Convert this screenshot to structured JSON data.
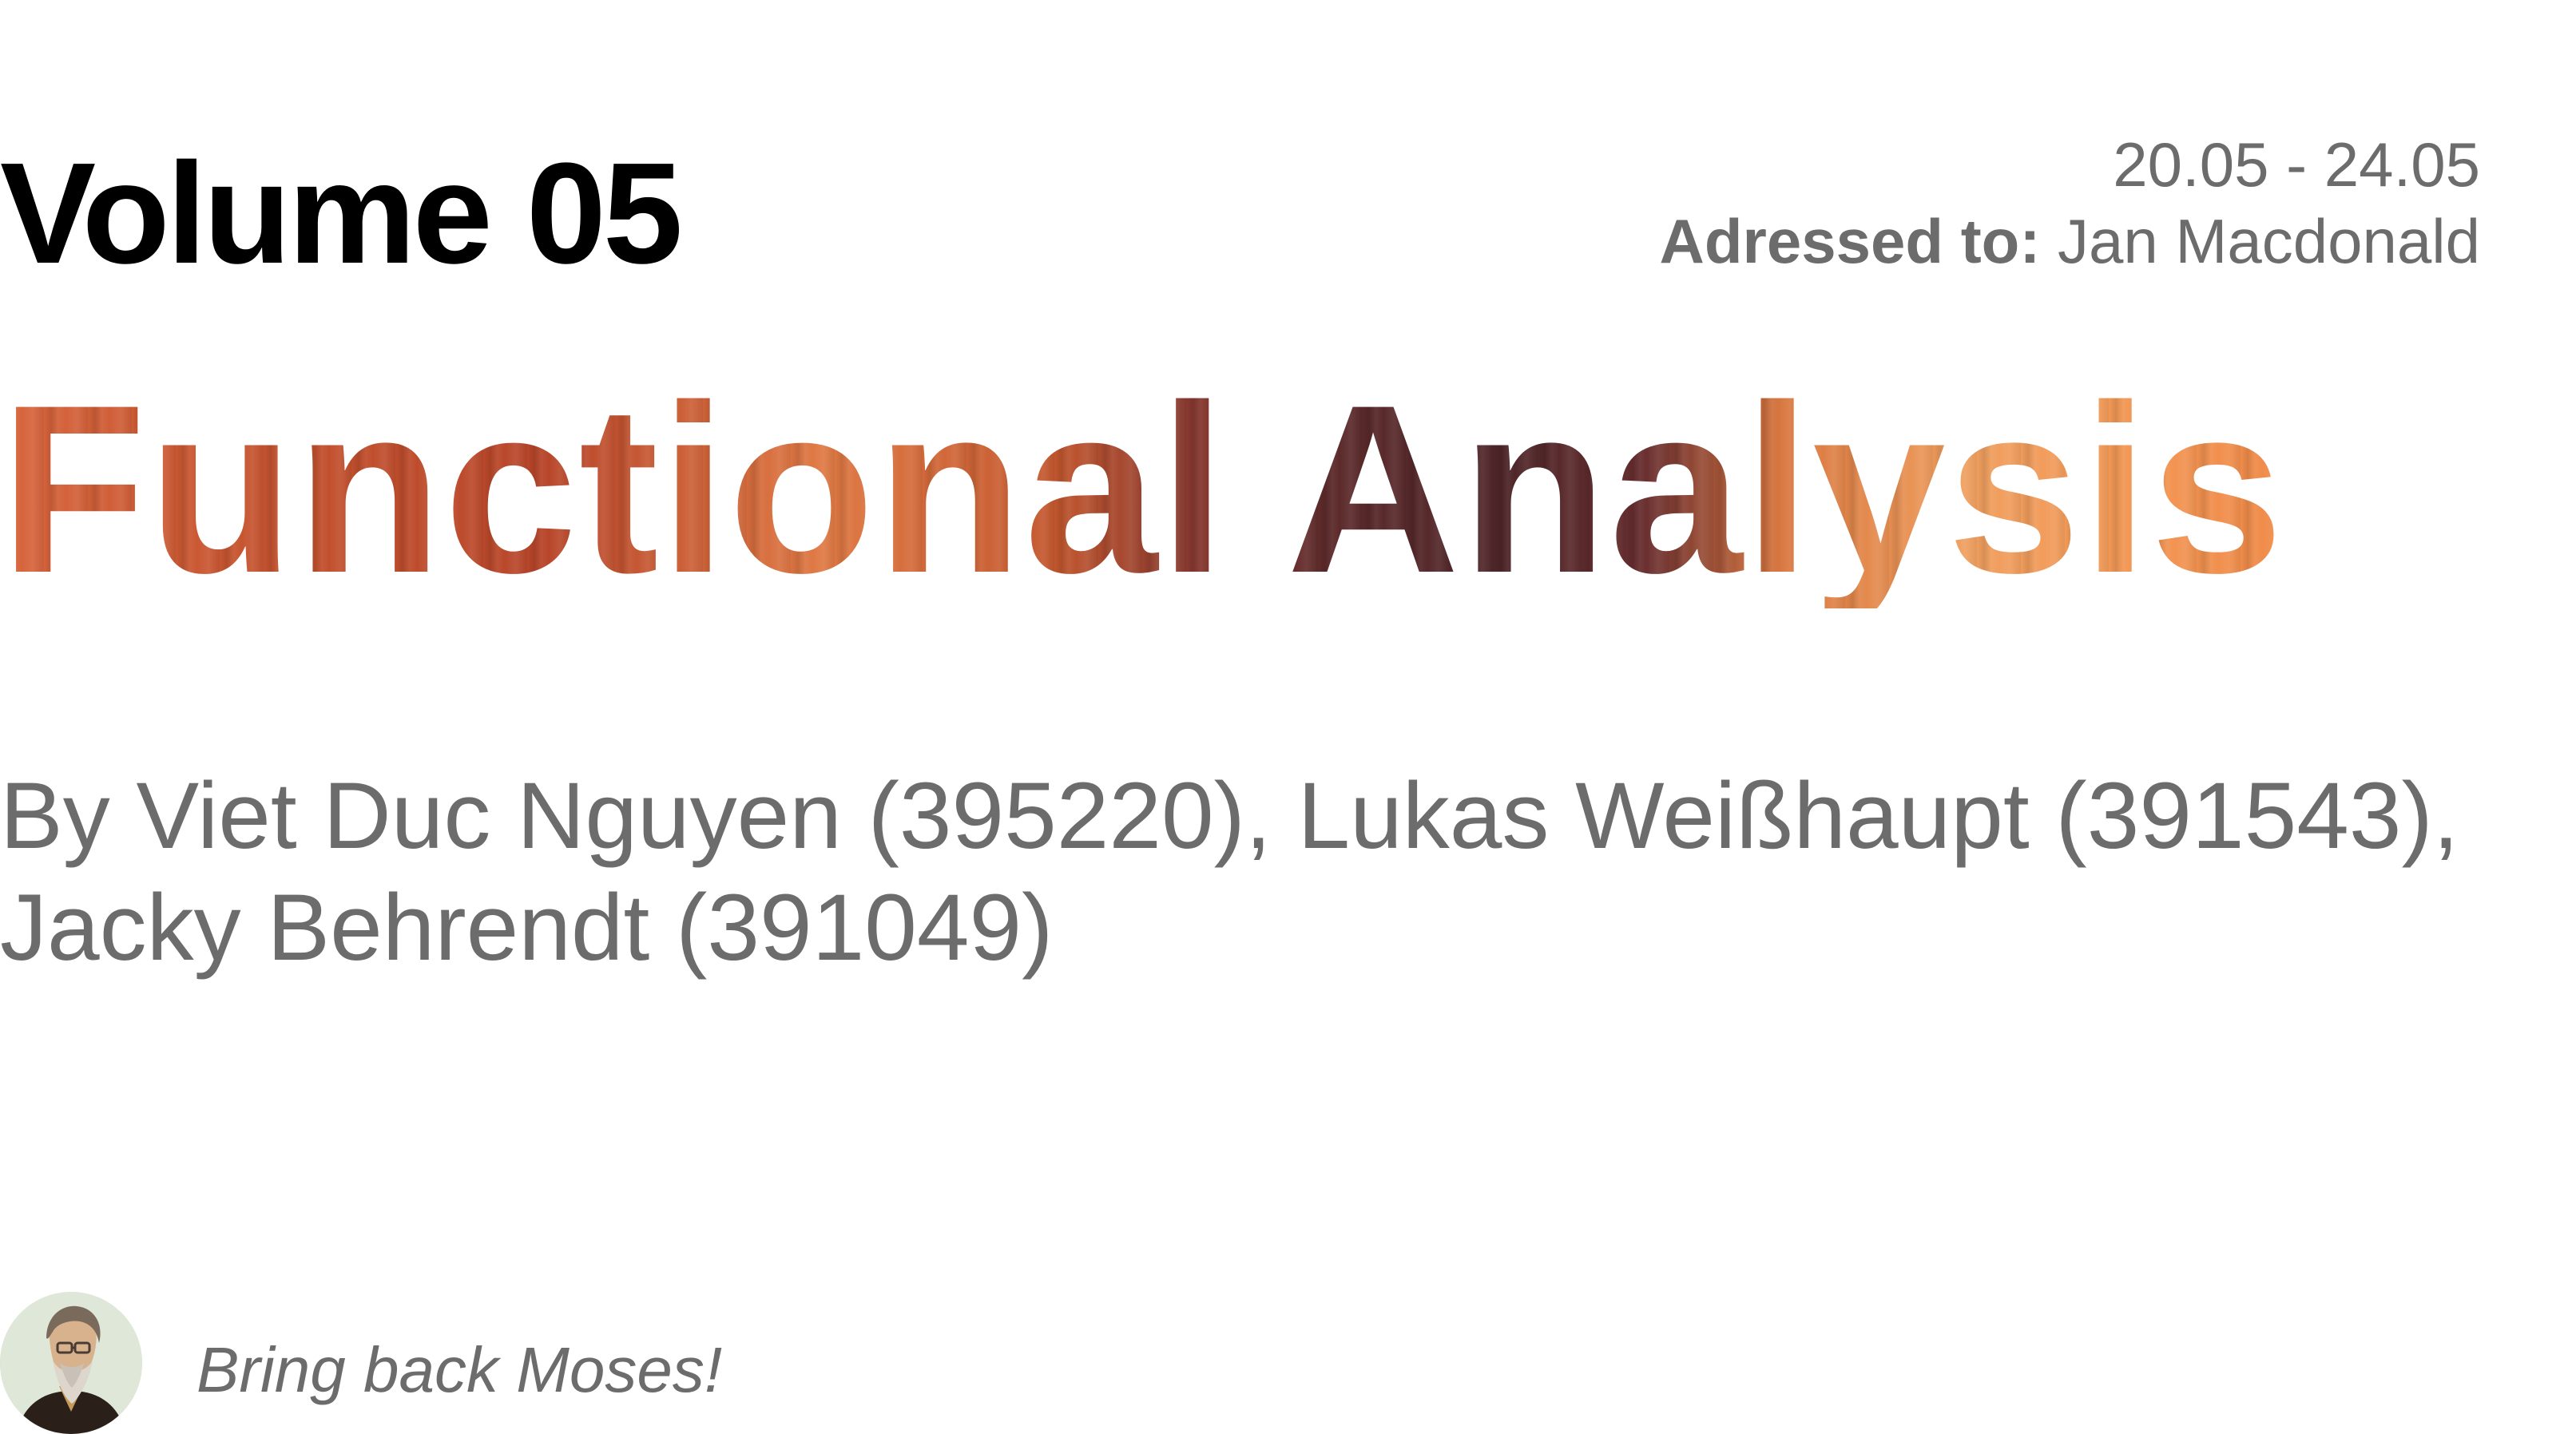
{
  "header": {
    "volume": "Volume 05",
    "date_range": "20.05 - 24.05",
    "addressed_label": "Adressed to:",
    "addressed_name": "Jan Macdonald"
  },
  "title": "Functional Analysis",
  "authors": {
    "line1": "By Viet Duc Nguyen (395220), Lukas Weißhaupt (391543),",
    "line2": "Jacky Behrendt (391049)"
  },
  "footer": {
    "tagline": "Bring back Moses!"
  },
  "colors": {
    "text_primary": "#000000",
    "text_muted": "#6c6c6c",
    "title_gradient": [
      "#d8663e",
      "#c5532f",
      "#4e2629",
      "#f0a060",
      "#f08a48"
    ],
    "background": "#ffffff"
  }
}
